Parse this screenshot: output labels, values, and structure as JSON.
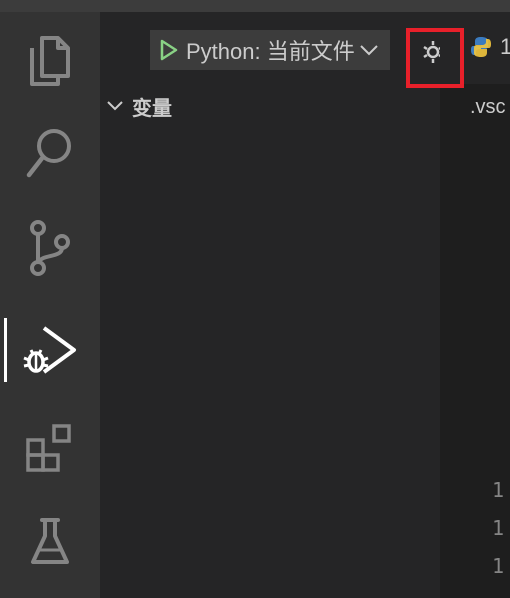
{
  "debug": {
    "config_label": "Python: 当前文件"
  },
  "sidebar": {
    "variables_title": "变量"
  },
  "editor": {
    "tab_label_partial": "1",
    "breadcrumb_partial": ".vsc",
    "line_numbers": [
      "1",
      "1",
      "1"
    ]
  },
  "activity_bar": {
    "items": [
      {
        "icon": "files-icon"
      },
      {
        "icon": "search-icon"
      },
      {
        "icon": "source-control-icon"
      },
      {
        "icon": "run-debug-icon",
        "active": true
      },
      {
        "icon": "extensions-icon"
      },
      {
        "icon": "testing-icon"
      }
    ]
  },
  "colors": {
    "activity_bar": "#333333",
    "sidebar": "#252526",
    "editor": "#1e1e1e",
    "run_green": "#89d185",
    "highlight": "#e8202a"
  }
}
